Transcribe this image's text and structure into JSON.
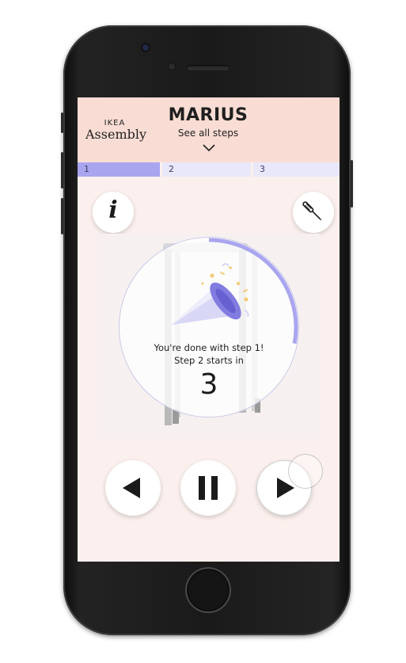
{
  "app": {
    "brand_top": "IKEA",
    "brand_bottom": "Assembly",
    "product_title": "MARIUS",
    "see_all_label": "See all steps"
  },
  "steps": [
    {
      "label": "1",
      "active": true
    },
    {
      "label": "2",
      "active": false
    },
    {
      "label": "3",
      "active": false
    }
  ],
  "buttons": {
    "info_label": "i",
    "tool_icon": "screwdriver-icon",
    "prev_icon": "play-back-icon",
    "pause_icon": "pause-icon",
    "next_icon": "play-forward-icon"
  },
  "overlay": {
    "done_line1": "You're done with step 1!",
    "done_line2": "Step 2 starts in",
    "countdown": "3",
    "progress_fraction": 0.28,
    "illustration": "party-popper-icon"
  },
  "colors": {
    "header_bg": "#f9ddd4",
    "screen_bg": "#fbf0ed",
    "accent": "#a9a5ef",
    "accent_dark": "#7c76e0",
    "inactive_step": "#e9e8fb"
  }
}
